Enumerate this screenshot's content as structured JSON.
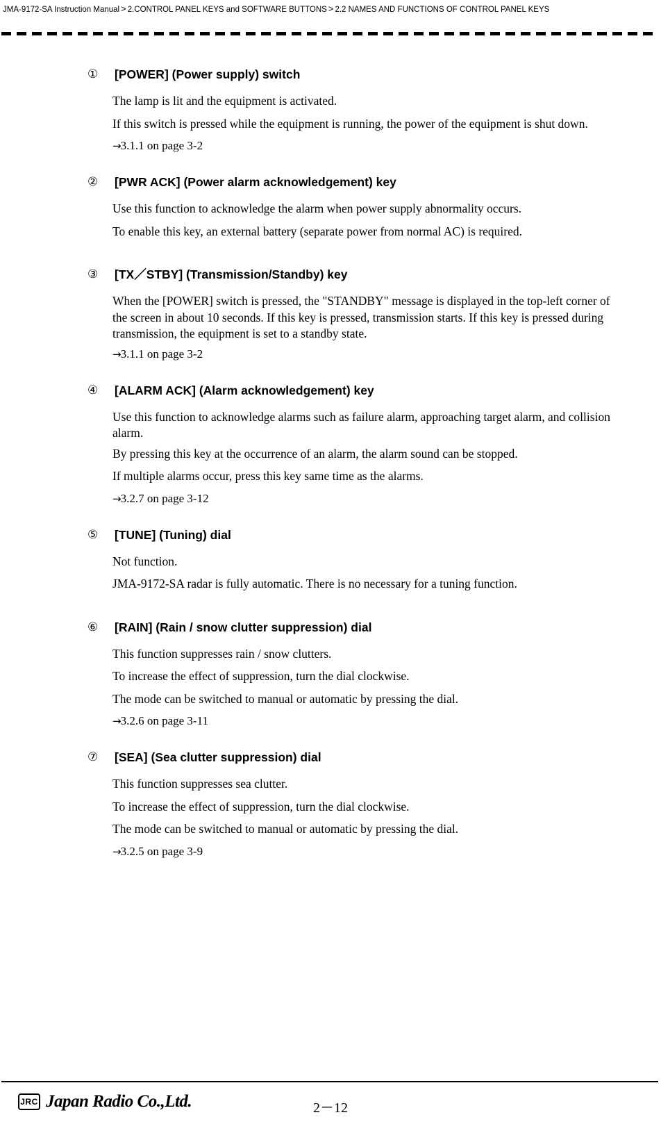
{
  "header": {
    "crumb1": "JMA-9172-SA Instruction Manual",
    "sep1": ">",
    "crumb2": "2.CONTROL PANEL KEYS and SOFTWARE BUTTONS",
    "sep2": ">",
    "crumb3": "2.2  NAMES AND FUNCTIONS OF CONTROL PANEL KEYS"
  },
  "sections": [
    {
      "num": "①",
      "title": "[POWER] (Power supply) switch",
      "paras": [
        "The lamp is lit and the equipment is activated.",
        "If this switch is pressed while the equipment is running, the power of the equipment is shut down."
      ],
      "ref": "3.1.1 on page 3-2"
    },
    {
      "num": "②",
      "title": "[PWR ACK] (Power alarm acknowledgement) key",
      "paras": [
        "Use this function to acknowledge the alarm when power supply abnormality occurs.",
        "To enable this key, an external battery (separate power from normal AC) is required."
      ],
      "ref": ""
    },
    {
      "num": "③",
      "title": "[TX／STBY] (Transmission/Standby) key",
      "paras": [
        "When the [POWER] switch is pressed, the \"STANDBY\" message is displayed in the top-left corner of the screen in about 10 seconds.  If this key is pressed, transmission starts. If this key is pressed during transmission, the equipment is set to a standby state."
      ],
      "ref": "3.1.1 on page 3-2"
    },
    {
      "num": "④",
      "title": "[ALARM ACK] (Alarm acknowledgement) key",
      "paras": [
        "Use this function to acknowledge alarms such as failure alarm, approaching target alarm, and collision alarm.",
        "By pressing this key at the occurrence of an alarm, the alarm sound can be stopped.",
        "If multiple alarms occur, press this key same time as the alarms."
      ],
      "ref": "3.2.7 on page 3-12"
    },
    {
      "num": "⑤",
      "title": "[TUNE] (Tuning) dial",
      "paras": [
        "Not function.",
        "JMA-9172-SA radar is fully automatic. There is no necessary for a tuning function."
      ],
      "ref": ""
    },
    {
      "num": "⑥",
      "title": "[RAIN] (Rain / snow clutter suppression) dial",
      "paras": [
        "This function suppresses rain / snow clutters.",
        "To increase the effect of suppression, turn the dial clockwise.",
        "The mode can be switched to manual or automatic by pressing the dial."
      ],
      "ref": "3.2.6 on page 3-11"
    },
    {
      "num": "⑦",
      "title": "[SEA] (Sea clutter suppression) dial",
      "paras": [
        "This function suppresses sea clutter.",
        "To increase the effect of suppression, turn the dial clockwise.",
        "The mode can be switched to manual or automatic by pressing the dial."
      ],
      "ref": "3.2.5 on page 3-9"
    }
  ],
  "footer": {
    "logo_mark": "JRC",
    "logo_name": "Japan Radio Co.,Ltd.",
    "page": "2－12"
  }
}
